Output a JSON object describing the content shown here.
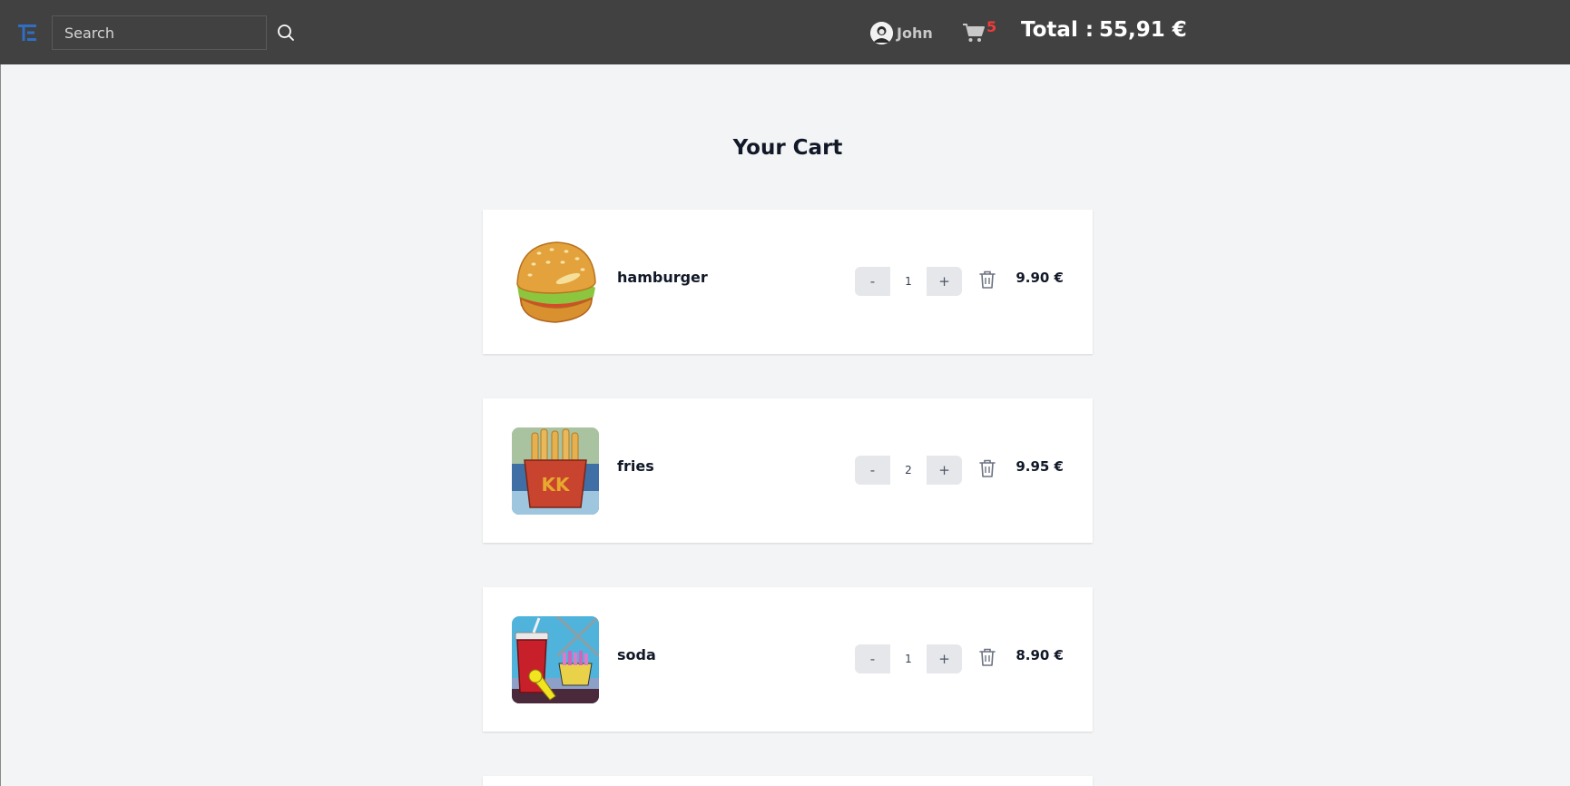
{
  "navbar": {
    "search": {
      "placeholder": "Search"
    },
    "user": {
      "name": "John"
    },
    "cart": {
      "count": "5"
    },
    "total": {
      "label": "Total :",
      "value": "55,91 €"
    },
    "colors": {
      "background": "#414141",
      "logo": "#2f6ec2",
      "badge": "#ef3b3b"
    }
  },
  "page": {
    "title": "Your Cart"
  },
  "cart": {
    "items": [
      {
        "name": "hamburger",
        "quantity": "1",
        "price": "9.90 €",
        "image": "hamburger-image",
        "minus_label": "-",
        "plus_label": "+"
      },
      {
        "name": "fries",
        "quantity": "2",
        "price": "9.95 €",
        "image": "fries-image",
        "minus_label": "-",
        "plus_label": "+"
      },
      {
        "name": "soda",
        "quantity": "1",
        "price": "8.90 €",
        "image": "soda-image",
        "minus_label": "-",
        "plus_label": "+"
      }
    ]
  }
}
